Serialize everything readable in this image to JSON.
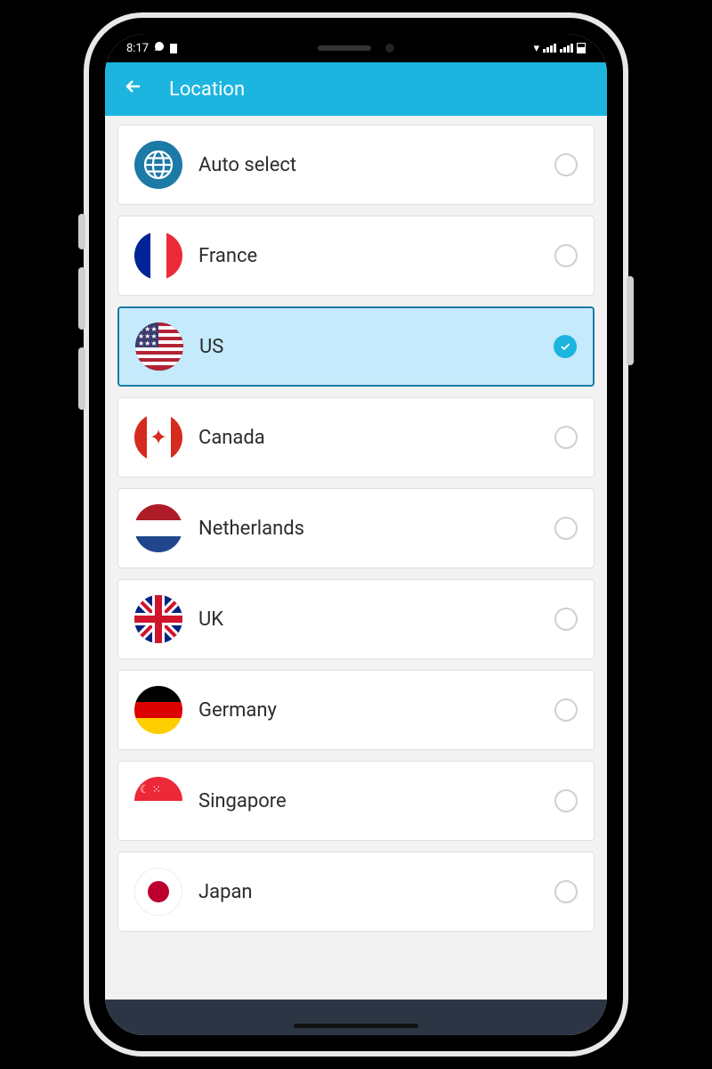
{
  "status": {
    "time": "8:17",
    "icons_left": [
      "whatsapp",
      "notification"
    ],
    "icons_right": [
      "wifi",
      "signal",
      "signal",
      "battery"
    ]
  },
  "header": {
    "back_icon": "arrow-left",
    "title": "Location"
  },
  "locations": [
    {
      "label": "Auto select",
      "flag": "globe",
      "selected": false
    },
    {
      "label": "France",
      "flag": "france",
      "selected": false
    },
    {
      "label": "US",
      "flag": "us",
      "selected": true
    },
    {
      "label": "Canada",
      "flag": "canada",
      "selected": false
    },
    {
      "label": "Netherlands",
      "flag": "netherlands",
      "selected": false
    },
    {
      "label": "UK",
      "flag": "uk",
      "selected": false
    },
    {
      "label": "Germany",
      "flag": "germany",
      "selected": false
    },
    {
      "label": "Singapore",
      "flag": "singapore",
      "selected": false
    },
    {
      "label": "Japan",
      "flag": "japan",
      "selected": false
    }
  ],
  "colors": {
    "accent": "#1CB5E0",
    "selected_bg": "#c4eafb",
    "selected_border": "#1b7aa6"
  }
}
